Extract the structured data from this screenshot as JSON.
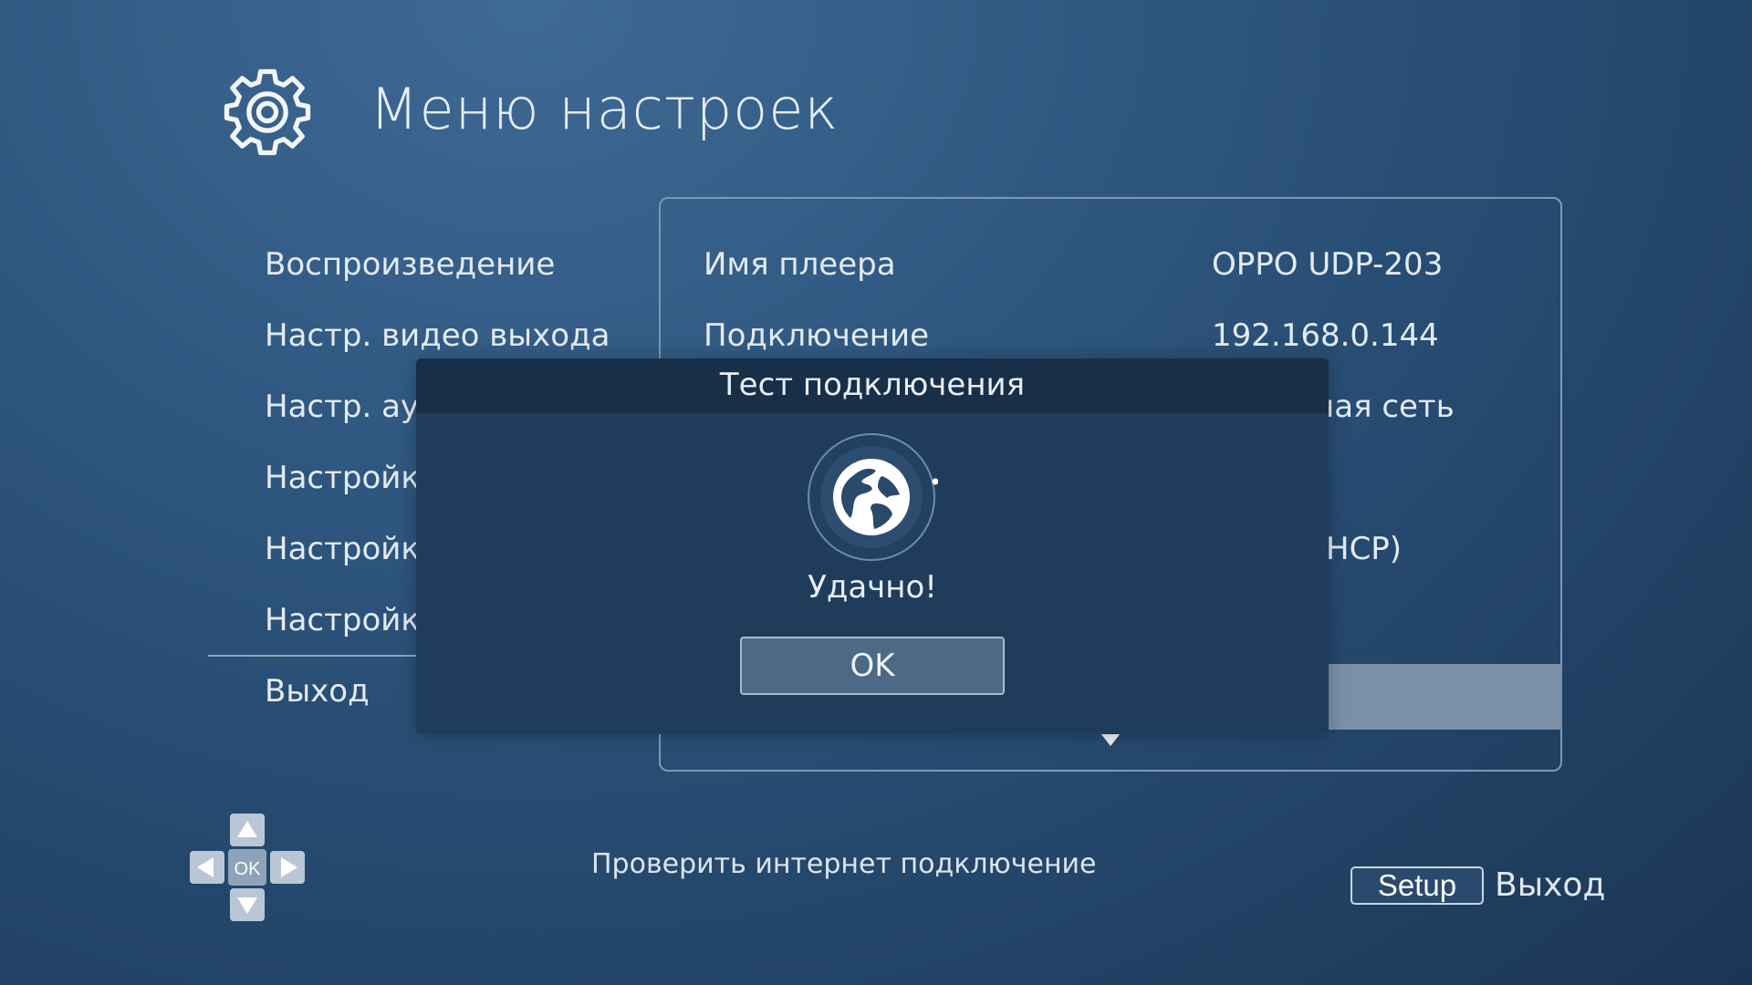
{
  "header": {
    "title": "Меню настроек",
    "icon": "gear-icon"
  },
  "sidebar": {
    "items": [
      {
        "label": "Воспроизведение"
      },
      {
        "label": "Настр. видео выхода"
      },
      {
        "label": "Настр. ауд"
      },
      {
        "label": "Настройка"
      },
      {
        "label": "Настройка"
      },
      {
        "label": "Настройка"
      },
      {
        "label": "Выход"
      }
    ]
  },
  "panel": {
    "rows": [
      {
        "label": "Имя плеера",
        "value": "OPPO UDP-203"
      },
      {
        "label": "Подключение",
        "value": "192.168.0.144"
      },
      {
        "label": "",
        "value": "ная сеть"
      },
      {
        "label": "",
        "value": "HCP)"
      }
    ],
    "scroll_indicator": "chevron-down-icon"
  },
  "dialog": {
    "title": "Тест подключения",
    "icon": "globe-icon",
    "status": "Удачно!",
    "ok_label": "OK"
  },
  "footer": {
    "dpad_center_label": "OK",
    "hint": "Проверить интернет подключение",
    "setup_key_label": "Setup",
    "setup_action": "Выход"
  },
  "colors": {
    "background": "#2f5780",
    "dialog": "#1f3c5b",
    "dialog_header": "#182f48",
    "highlight": "#7990a7",
    "ok_button": "#4c6985"
  }
}
